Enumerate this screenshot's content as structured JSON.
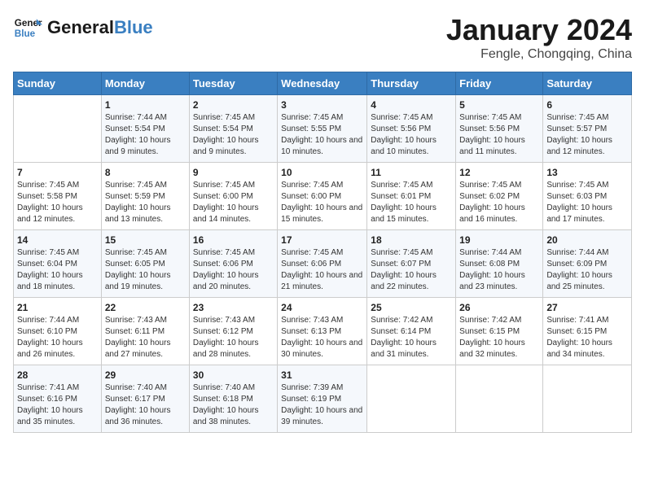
{
  "header": {
    "logo_line1": "General",
    "logo_line2": "Blue",
    "month_year": "January 2024",
    "location": "Fengle, Chongqing, China"
  },
  "weekdays": [
    "Sunday",
    "Monday",
    "Tuesday",
    "Wednesday",
    "Thursday",
    "Friday",
    "Saturday"
  ],
  "weeks": [
    [
      {
        "day": "",
        "sunrise": "",
        "sunset": "",
        "daylight": ""
      },
      {
        "day": "1",
        "sunrise": "Sunrise: 7:44 AM",
        "sunset": "Sunset: 5:54 PM",
        "daylight": "Daylight: 10 hours and 9 minutes."
      },
      {
        "day": "2",
        "sunrise": "Sunrise: 7:45 AM",
        "sunset": "Sunset: 5:54 PM",
        "daylight": "Daylight: 10 hours and 9 minutes."
      },
      {
        "day": "3",
        "sunrise": "Sunrise: 7:45 AM",
        "sunset": "Sunset: 5:55 PM",
        "daylight": "Daylight: 10 hours and 10 minutes."
      },
      {
        "day": "4",
        "sunrise": "Sunrise: 7:45 AM",
        "sunset": "Sunset: 5:56 PM",
        "daylight": "Daylight: 10 hours and 10 minutes."
      },
      {
        "day": "5",
        "sunrise": "Sunrise: 7:45 AM",
        "sunset": "Sunset: 5:56 PM",
        "daylight": "Daylight: 10 hours and 11 minutes."
      },
      {
        "day": "6",
        "sunrise": "Sunrise: 7:45 AM",
        "sunset": "Sunset: 5:57 PM",
        "daylight": "Daylight: 10 hours and 12 minutes."
      }
    ],
    [
      {
        "day": "7",
        "sunrise": "Sunrise: 7:45 AM",
        "sunset": "Sunset: 5:58 PM",
        "daylight": "Daylight: 10 hours and 12 minutes."
      },
      {
        "day": "8",
        "sunrise": "Sunrise: 7:45 AM",
        "sunset": "Sunset: 5:59 PM",
        "daylight": "Daylight: 10 hours and 13 minutes."
      },
      {
        "day": "9",
        "sunrise": "Sunrise: 7:45 AM",
        "sunset": "Sunset: 6:00 PM",
        "daylight": "Daylight: 10 hours and 14 minutes."
      },
      {
        "day": "10",
        "sunrise": "Sunrise: 7:45 AM",
        "sunset": "Sunset: 6:00 PM",
        "daylight": "Daylight: 10 hours and 15 minutes."
      },
      {
        "day": "11",
        "sunrise": "Sunrise: 7:45 AM",
        "sunset": "Sunset: 6:01 PM",
        "daylight": "Daylight: 10 hours and 15 minutes."
      },
      {
        "day": "12",
        "sunrise": "Sunrise: 7:45 AM",
        "sunset": "Sunset: 6:02 PM",
        "daylight": "Daylight: 10 hours and 16 minutes."
      },
      {
        "day": "13",
        "sunrise": "Sunrise: 7:45 AM",
        "sunset": "Sunset: 6:03 PM",
        "daylight": "Daylight: 10 hours and 17 minutes."
      }
    ],
    [
      {
        "day": "14",
        "sunrise": "Sunrise: 7:45 AM",
        "sunset": "Sunset: 6:04 PM",
        "daylight": "Daylight: 10 hours and 18 minutes."
      },
      {
        "day": "15",
        "sunrise": "Sunrise: 7:45 AM",
        "sunset": "Sunset: 6:05 PM",
        "daylight": "Daylight: 10 hours and 19 minutes."
      },
      {
        "day": "16",
        "sunrise": "Sunrise: 7:45 AM",
        "sunset": "Sunset: 6:06 PM",
        "daylight": "Daylight: 10 hours and 20 minutes."
      },
      {
        "day": "17",
        "sunrise": "Sunrise: 7:45 AM",
        "sunset": "Sunset: 6:06 PM",
        "daylight": "Daylight: 10 hours and 21 minutes."
      },
      {
        "day": "18",
        "sunrise": "Sunrise: 7:45 AM",
        "sunset": "Sunset: 6:07 PM",
        "daylight": "Daylight: 10 hours and 22 minutes."
      },
      {
        "day": "19",
        "sunrise": "Sunrise: 7:44 AM",
        "sunset": "Sunset: 6:08 PM",
        "daylight": "Daylight: 10 hours and 23 minutes."
      },
      {
        "day": "20",
        "sunrise": "Sunrise: 7:44 AM",
        "sunset": "Sunset: 6:09 PM",
        "daylight": "Daylight: 10 hours and 25 minutes."
      }
    ],
    [
      {
        "day": "21",
        "sunrise": "Sunrise: 7:44 AM",
        "sunset": "Sunset: 6:10 PM",
        "daylight": "Daylight: 10 hours and 26 minutes."
      },
      {
        "day": "22",
        "sunrise": "Sunrise: 7:43 AM",
        "sunset": "Sunset: 6:11 PM",
        "daylight": "Daylight: 10 hours and 27 minutes."
      },
      {
        "day": "23",
        "sunrise": "Sunrise: 7:43 AM",
        "sunset": "Sunset: 6:12 PM",
        "daylight": "Daylight: 10 hours and 28 minutes."
      },
      {
        "day": "24",
        "sunrise": "Sunrise: 7:43 AM",
        "sunset": "Sunset: 6:13 PM",
        "daylight": "Daylight: 10 hours and 30 minutes."
      },
      {
        "day": "25",
        "sunrise": "Sunrise: 7:42 AM",
        "sunset": "Sunset: 6:14 PM",
        "daylight": "Daylight: 10 hours and 31 minutes."
      },
      {
        "day": "26",
        "sunrise": "Sunrise: 7:42 AM",
        "sunset": "Sunset: 6:15 PM",
        "daylight": "Daylight: 10 hours and 32 minutes."
      },
      {
        "day": "27",
        "sunrise": "Sunrise: 7:41 AM",
        "sunset": "Sunset: 6:15 PM",
        "daylight": "Daylight: 10 hours and 34 minutes."
      }
    ],
    [
      {
        "day": "28",
        "sunrise": "Sunrise: 7:41 AM",
        "sunset": "Sunset: 6:16 PM",
        "daylight": "Daylight: 10 hours and 35 minutes."
      },
      {
        "day": "29",
        "sunrise": "Sunrise: 7:40 AM",
        "sunset": "Sunset: 6:17 PM",
        "daylight": "Daylight: 10 hours and 36 minutes."
      },
      {
        "day": "30",
        "sunrise": "Sunrise: 7:40 AM",
        "sunset": "Sunset: 6:18 PM",
        "daylight": "Daylight: 10 hours and 38 minutes."
      },
      {
        "day": "31",
        "sunrise": "Sunrise: 7:39 AM",
        "sunset": "Sunset: 6:19 PM",
        "daylight": "Daylight: 10 hours and 39 minutes."
      },
      {
        "day": "",
        "sunrise": "",
        "sunset": "",
        "daylight": ""
      },
      {
        "day": "",
        "sunrise": "",
        "sunset": "",
        "daylight": ""
      },
      {
        "day": "",
        "sunrise": "",
        "sunset": "",
        "daylight": ""
      }
    ]
  ]
}
